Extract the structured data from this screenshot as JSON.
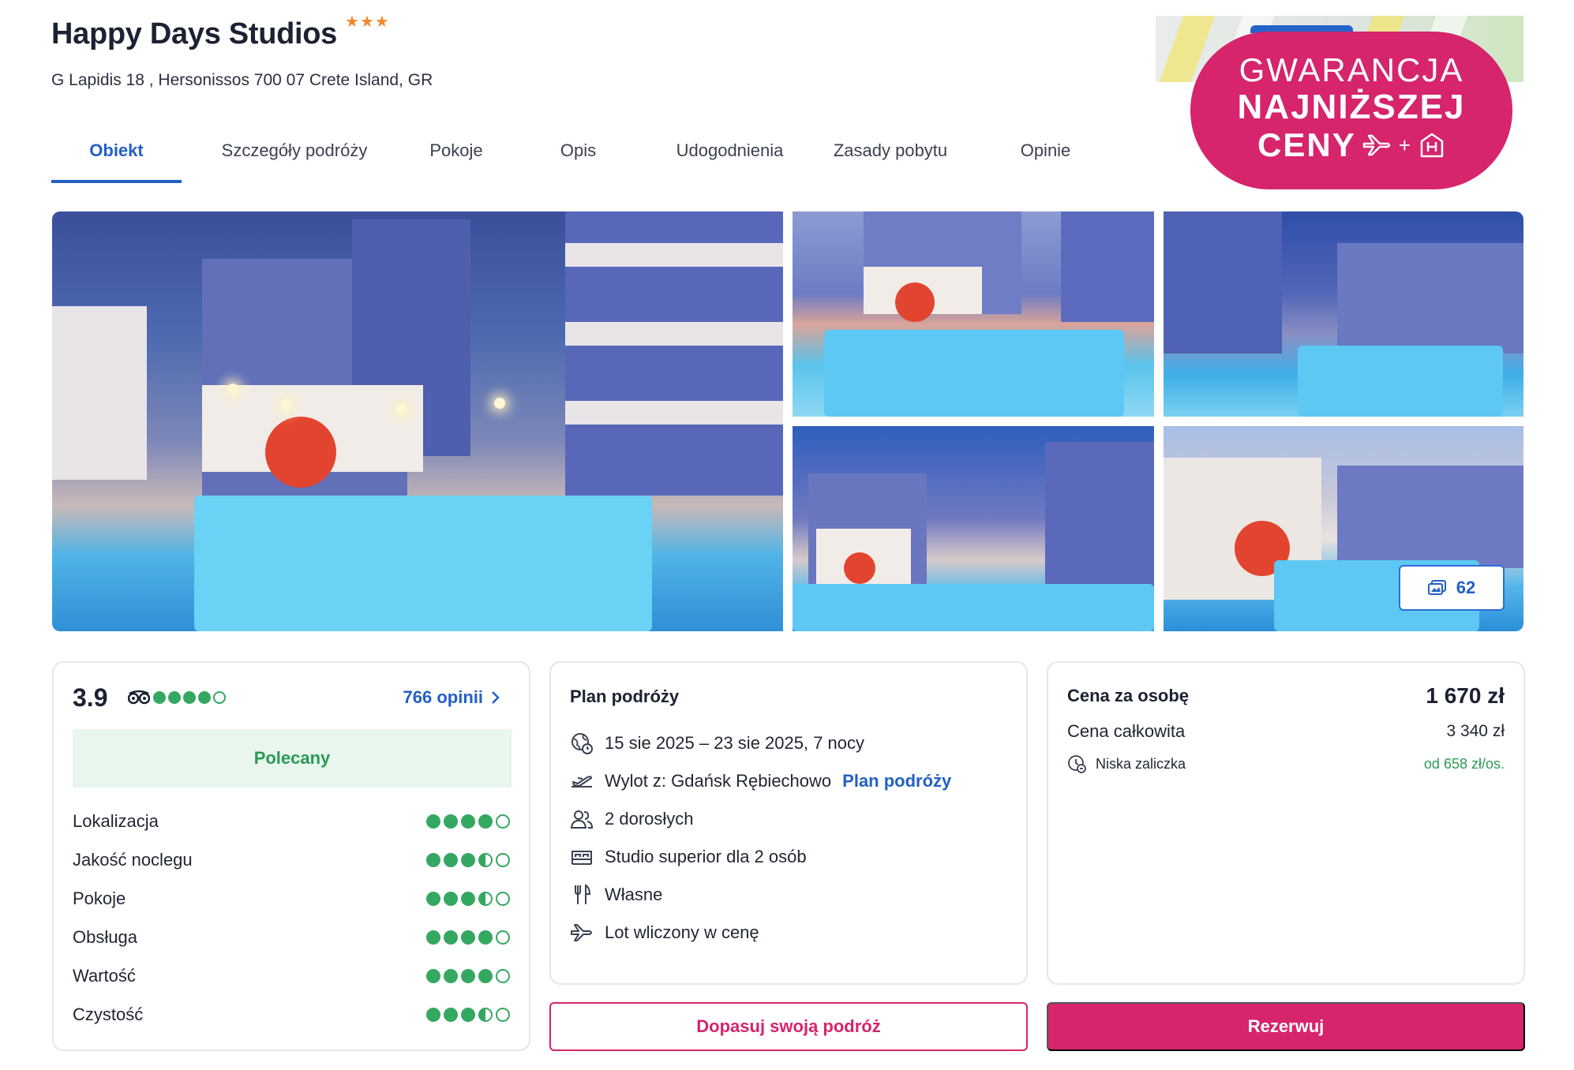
{
  "hotel": {
    "name": "Happy Days Studios",
    "stars": "★★★",
    "address": "G Lapidis 18 , Hersonissos 700 07 Crete Island, GR"
  },
  "tabs": [
    {
      "label": "Obiekt",
      "active": true
    },
    {
      "label": "Szczegóły podróży",
      "active": false
    },
    {
      "label": "Pokoje",
      "active": false
    },
    {
      "label": "Opis",
      "active": false
    },
    {
      "label": "Udogodnienia",
      "active": false
    },
    {
      "label": "Zasady pobytu",
      "active": false
    },
    {
      "label": "Opinie",
      "active": false
    }
  ],
  "badge": {
    "line1": "GWARANCJA",
    "line2": "NAJNIŻSZEJ",
    "line3": "CENY",
    "color": "#d6246d",
    "icons": [
      "plane-icon",
      "hotel-icon"
    ]
  },
  "gallery": {
    "photo_count": "62"
  },
  "rating": {
    "score": "3.9",
    "tripadvisor_bubbles": 4,
    "reviews_link": "766 opinii",
    "recommended_label": "Polecany",
    "criteria": [
      {
        "label": "Lokalizacja",
        "value": 4
      },
      {
        "label": "Jakość noclegu",
        "value": 3.5
      },
      {
        "label": "Pokoje",
        "value": 3.5
      },
      {
        "label": "Obsługa",
        "value": 4
      },
      {
        "label": "Wartość",
        "value": 4
      },
      {
        "label": "Czystość",
        "value": 3.5
      }
    ]
  },
  "plan": {
    "title": "Plan podróży",
    "dates": "15 sie 2025 – 23 sie 2025, 7 nocy",
    "departure": "Wylot z: Gdańsk Rębiechowo",
    "departure_link": "Plan podróży",
    "guests": "2 dorosłych",
    "room": "Studio superior dla 2 osób",
    "board": "Własne",
    "flight": "Lot wliczony w cenę"
  },
  "price": {
    "per_person_label": "Cena za osobę",
    "per_person_value": "1 670 zł",
    "total_label": "Cena całkowita",
    "total_value": "3 340 zł",
    "deposit_label": "Niska zaliczka",
    "deposit_value": "od 658 zł/os."
  },
  "buttons": {
    "customize": "Dopasuj swoją podróż",
    "book": "Rezerwuj"
  },
  "colors": {
    "accent": "#d6246d",
    "link": "#2360c4",
    "rating_green": "#34a860"
  }
}
